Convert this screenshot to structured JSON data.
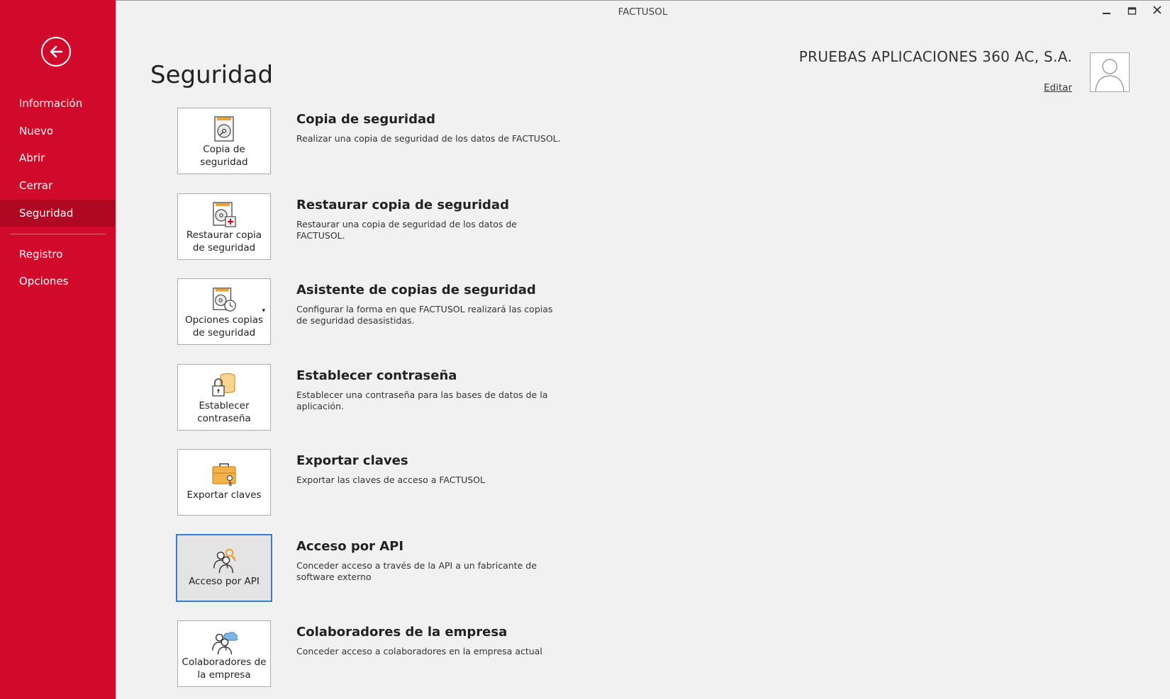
{
  "window": {
    "title": "FACTUSOL"
  },
  "sidebar": {
    "items": [
      {
        "label": "Información"
      },
      {
        "label": "Nuevo"
      },
      {
        "label": "Abrir"
      },
      {
        "label": "Cerrar"
      },
      {
        "label": "Seguridad",
        "active": true
      },
      {
        "label": "Registro"
      },
      {
        "label": "Opciones"
      }
    ]
  },
  "page": {
    "title": "Seguridad"
  },
  "company": {
    "name": "PRUEBAS APLICACIONES 360 AC, S.A.",
    "edit_label": "Editar"
  },
  "colors": {
    "accent": "#d1092a",
    "accent_active": "#b00722",
    "selection": "#3b7ad1"
  },
  "items": [
    {
      "tile_label": "Copia de seguridad",
      "title": "Copia de seguridad",
      "description": "Realizar una copia de seguridad de los datos de FACTUSOL.",
      "icon": "backup-disk-icon"
    },
    {
      "tile_label": "Restaurar copia de seguridad",
      "title": "Restaurar copia de seguridad",
      "description": "Restaurar una copia de seguridad de los datos de FACTUSOL.",
      "icon": "restore-disk-icon"
    },
    {
      "tile_label": "Opciones copias de seguridad",
      "title": "Asistente de copias de seguridad",
      "description": "Configurar la forma en que FACTUSOL realizará las copias de seguridad desasistidas.",
      "icon": "backup-schedule-icon",
      "dropdown": "▾"
    },
    {
      "tile_label": "Establecer contraseña",
      "title": "Establecer contraseña",
      "description": "Establecer una contraseña para las bases de datos de la aplicación.",
      "icon": "lock-database-icon"
    },
    {
      "tile_label": "Exportar claves",
      "title": "Exportar claves",
      "description": "Exportar las claves de acceso a FACTUSOL",
      "icon": "briefcase-key-icon"
    },
    {
      "tile_label": "Acceso por API",
      "title": "Acceso por API",
      "description": "Conceder acceso a través de la API a un fabricante de software externo",
      "icon": "users-key-icon",
      "selected": true
    },
    {
      "tile_label": "Colaboradores de la empresa",
      "title": "Colaboradores de la empresa",
      "description": "Conceder acceso a colaboradores en la empresa actual",
      "icon": "users-cloud-icon"
    }
  ]
}
